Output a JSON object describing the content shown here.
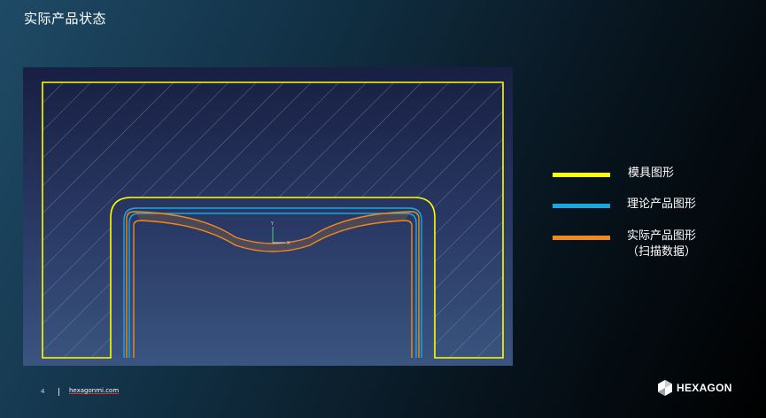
{
  "slide": {
    "title": "实际产品状态",
    "page_number": "4",
    "site": "hexagonmi.com"
  },
  "axis": {
    "y": "Y",
    "x": "X"
  },
  "legend": {
    "items": [
      {
        "label": "模具图形",
        "color": "#ffff00"
      },
      {
        "label": "理论产品图形",
        "color": "#18a8e0"
      },
      {
        "label": "实际产品图形",
        "sublabel": "（扫描数据）",
        "color": "#f08a1e"
      }
    ]
  },
  "brand": {
    "name": "HEXAGON"
  },
  "colors": {
    "hatch": "#8fa0a8",
    "mold": "#ffff00",
    "theory": "#18a8e0",
    "actual": "#f08a1e"
  }
}
